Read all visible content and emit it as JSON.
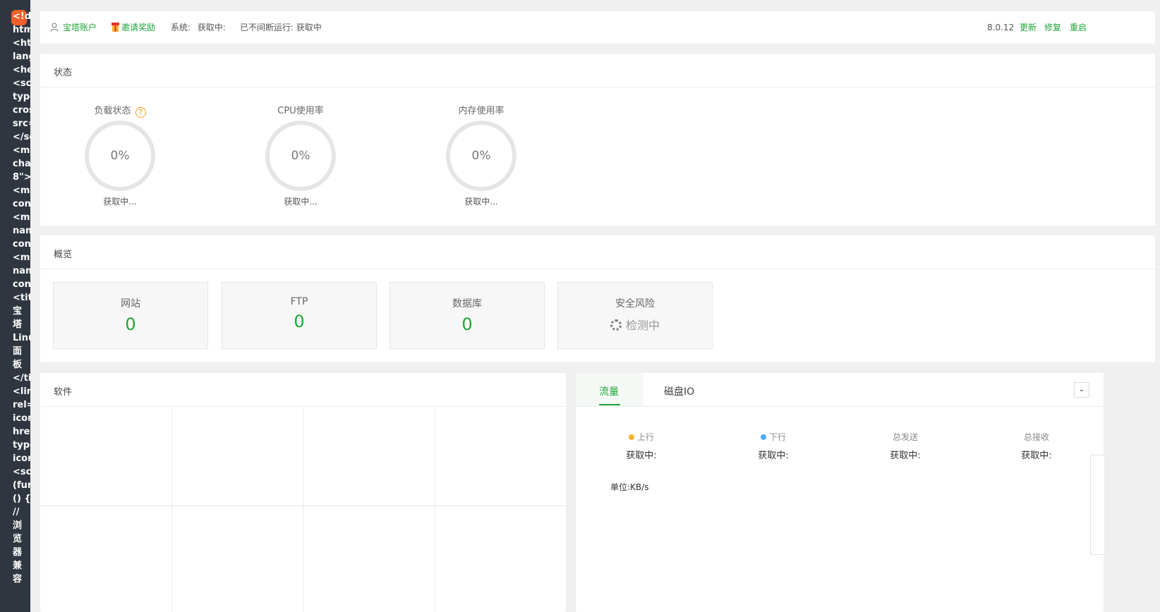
{
  "code_strip": [
    "<!do",
    "htm",
    "<htr",
    "lang",
    "<hea",
    "<scr",
    "type",
    "cros",
    "src=",
    "</sc",
    "<me",
    "char",
    "8\">",
    "<me",
    "con",
    "<me",
    "nam",
    "con",
    "<me",
    "nam",
    "con",
    "<titl",
    "宝",
    "塔",
    "Linu",
    "面",
    "板",
    "</tit",
    "<lin",
    "rel=",
    "icon",
    "href",
    "type",
    "icon",
    "<scr",
    "(fun",
    "() {",
    "//",
    "浏",
    "览",
    "器",
    "兼",
    "容"
  ],
  "topbar": {
    "account": "宝塔账户",
    "invite": "邀请奖励",
    "system_label": "系统:",
    "system_value": "获取中:",
    "uptime": "已不间断运行: 获取中",
    "version": "8.0.12",
    "update": "更新",
    "repair": "修复",
    "restart": "重启"
  },
  "status": {
    "title": "状态",
    "gauges": [
      {
        "label": "负载状态",
        "value": "0%",
        "sub": "获取中..."
      },
      {
        "label": "CPU使用率",
        "value": "0%",
        "sub": "获取中..."
      },
      {
        "label": "内存使用率",
        "value": "0%",
        "sub": "获取中..."
      }
    ],
    "help": "?"
  },
  "overview": {
    "title": "概览",
    "items": [
      {
        "label": "网站",
        "value": "0"
      },
      {
        "label": "FTP",
        "value": "0"
      },
      {
        "label": "数据库",
        "value": "0"
      },
      {
        "label": "安全风险",
        "value": "检测中"
      }
    ]
  },
  "software": {
    "title": "软件"
  },
  "traffic": {
    "tabs": [
      "流量",
      "磁盘IO"
    ],
    "dropdown": "⌄",
    "stats": [
      {
        "label": "上行",
        "value": "获取中:",
        "dot": "#f7b32b"
      },
      {
        "label": "下行",
        "value": "获取中:",
        "dot": "#52a9ff"
      },
      {
        "label": "总发送",
        "value": "获取中:"
      },
      {
        "label": "总接收",
        "value": "获取中:"
      }
    ],
    "unit": "单位:KB/s"
  },
  "icons": {
    "account": "user-icon",
    "invite": "gift-icon",
    "help": "question-circle-icon",
    "spinner": "loading-spinner-icon",
    "dropdown": "chevron-down-icon"
  },
  "colors": {
    "accent": "#20a53a",
    "upload": "#f7b32b",
    "download": "#52a9ff",
    "help": "#f0a020"
  }
}
